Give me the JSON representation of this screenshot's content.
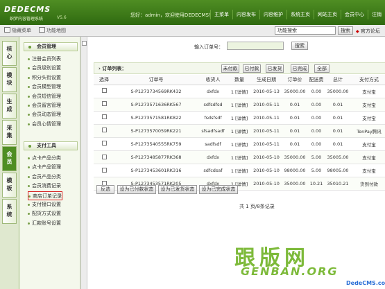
{
  "header": {
    "logo_text": "DEDECMS",
    "logo_subtitle": "织梦内容管理系统",
    "logo_version": "V5.6",
    "welcome": "您好：admin，欢迎使用DEDECMS！",
    "nav": [
      "主菜单",
      "内容发布",
      "内容维护",
      "系统主页",
      "网站主页",
      "会员中心",
      "注销"
    ]
  },
  "subbar": {
    "hide_menu": "隐藏菜单",
    "func_map": "功能地图",
    "func_search_value": "功能搜索",
    "search_btn": "搜索",
    "forum": "官方论坛"
  },
  "left_tabs": [
    "核心",
    "模块",
    "生成",
    "采集",
    "会员",
    "模板",
    "系统"
  ],
  "menu": {
    "group1_title": "会员管理",
    "group1_items": [
      "注册会员列表",
      "会员级别设置",
      "积分头衔设置",
      "会员模型管理",
      "会员短信管理",
      "会员留言管理",
      "会员动态管理",
      "会员心情管理"
    ],
    "group2_title": "支付工具",
    "group2_items": [
      "点卡产品分类",
      "点卡产品管理",
      "会员产品分类",
      "会员消费记录",
      "商店订单记录",
      "支付接口设置",
      "配货方式设置",
      "汇款账号设置"
    ]
  },
  "main": {
    "search_label": "输入订单号：",
    "search_btn": "搜索",
    "list_title": "› 订单列表：",
    "filter_buttons": [
      "未付款",
      "已付款",
      "已发货",
      "已完成",
      "全部"
    ],
    "columns": [
      "选择",
      "订单号",
      "收货人",
      "数量",
      "生成日期",
      "订单价",
      "配送费",
      "总计",
      "支付方式"
    ],
    "rows": [
      [
        "S-P1273734569RK432",
        "dxfdx",
        "1 [详情]",
        "2010-05-13",
        "35000.00",
        "0.00",
        "35000.00",
        "支付宝"
      ],
      [
        "S-P1273571636RK567",
        "sdfsdfsd",
        "1 [详情]",
        "2010-05-11",
        "0.01",
        "0.00",
        "0.01",
        "支付宝"
      ],
      [
        "S-P1273571581RK822",
        "fsdsfsdf",
        "1 [详情]",
        "2010-05-11",
        "0.01",
        "0.00",
        "0.01",
        "支付宝"
      ],
      [
        "S-P1273570059RK221",
        "sfsadfsadf",
        "1 [详情]",
        "2010-05-11",
        "0.01",
        "0.00",
        "0.01",
        "TenPay腾讯"
      ],
      [
        "S-P1273540555RK759",
        "sadfsdf",
        "1 [详情]",
        "2010-05-11",
        "0.01",
        "0.00",
        "0.01",
        "支付宝"
      ],
      [
        "S-P1273485877RK368",
        "dxfdx",
        "1 [详情]",
        "2010-05-10",
        "35000.00",
        "5.00",
        "35005.00",
        "支付宝"
      ],
      [
        "S-P1273453601RK316",
        "sdfcdsaf",
        "1 [详情]",
        "2010-05-10",
        "98000.00",
        "5.00",
        "98005.00",
        "支付宝"
      ],
      [
        "S-P1273453571RK205",
        "dxfdx",
        "1 [详情]",
        "2010-05-10",
        "35000.00",
        "10.21",
        "35010.21",
        "货到付款"
      ]
    ],
    "actions": [
      "反选",
      "设为已付款状态",
      "设为已发货状态",
      "设为已完成状态"
    ],
    "pager": "共 1 页/8条记录"
  },
  "watermark": {
    "cn": "跟版网",
    "en": "GENBAN.ORG",
    "url": "DedeCMS.com"
  }
}
